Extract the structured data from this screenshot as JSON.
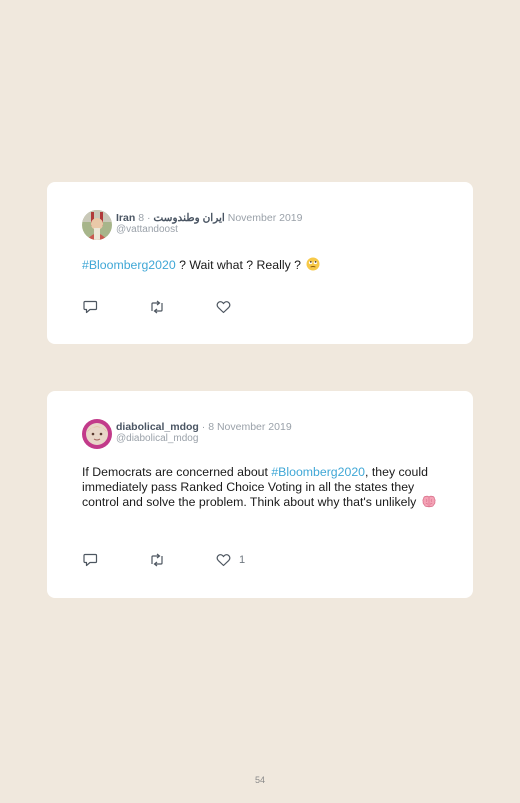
{
  "tweets": [
    {
      "author_name": "Iran ایران وطندوست",
      "separator": "·",
      "date": "8 November 2019",
      "handle": "@vattandoost",
      "text_hashtag": "#Bloomberg2020",
      "text_after": " ? Wait what ? Really ?",
      "emoji_icon": "face-with-rolling-eyes-icon",
      "likes": ""
    },
    {
      "author_name": "diabolical_mdog",
      "separator": "·",
      "date": "8 November 2019",
      "handle": "@diabolical_mdog",
      "text_before": "If Democrats are concerned about ",
      "text_hashtag": "#Bloomberg2020",
      "text_after": ", they could immediately pass Ranked Choice Voting in all the states they control and solve the problem. Think about why that's unlikely",
      "emoji_icon": "brain-icon",
      "likes": "1"
    }
  ],
  "page_number": "54",
  "colors": {
    "background": "#f0e8dd",
    "card": "#ffffff",
    "hashtag": "#3fa7d6",
    "muted": "#9aa1a9"
  }
}
